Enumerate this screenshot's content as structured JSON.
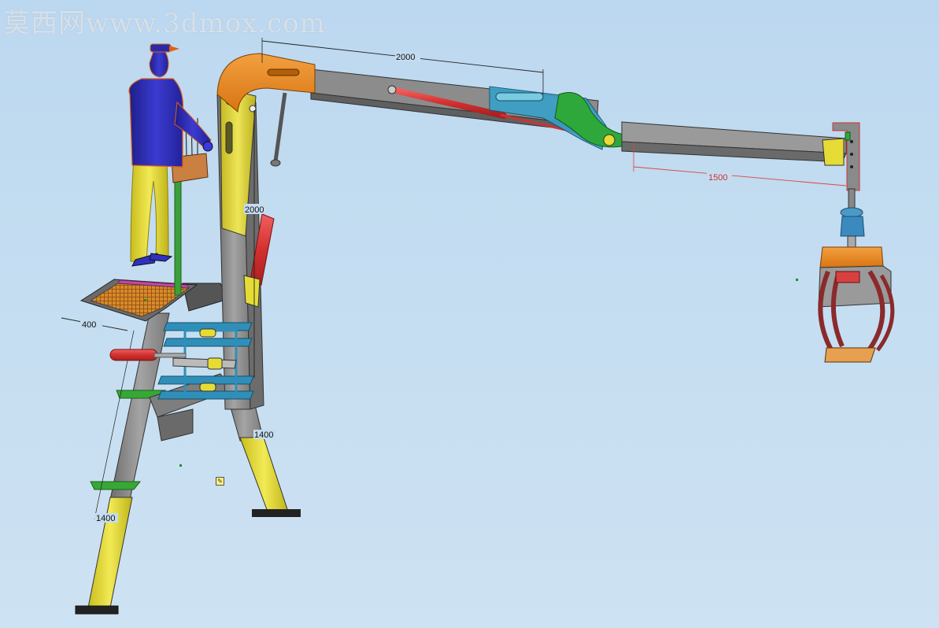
{
  "watermark": {
    "text": "莫西网www.3dmox.com"
  },
  "dimensions": {
    "boom_length": "2000",
    "mast_height": "2000",
    "jib_length": "1500",
    "platform_width": "400",
    "front_leg_length": "1400",
    "rear_leg_length": "1400"
  },
  "colors": {
    "background": "#c4dcef",
    "steel": "#8a8a8a",
    "orange": "#e8861a",
    "yellow": "#e6dc35",
    "blue_figure": "#2a2aa8",
    "cylinder_red": "#d83a3a",
    "clamp_teal": "#2f8fb8",
    "green": "#3aa03a"
  },
  "icons": {
    "sketch": "sketch-note-icon"
  }
}
